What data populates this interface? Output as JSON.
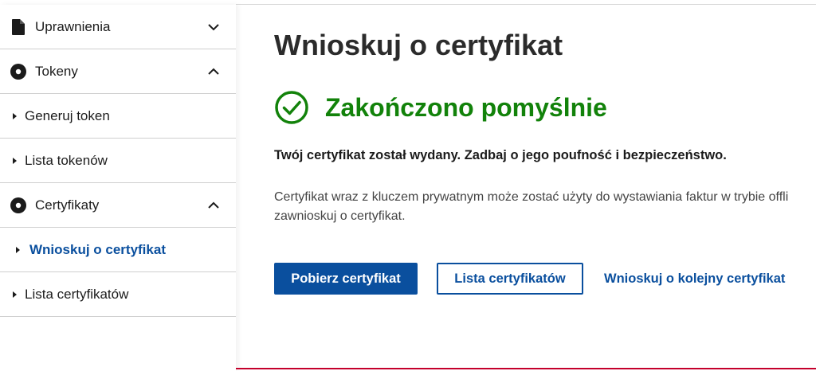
{
  "sidebar": {
    "items": [
      {
        "type": "section",
        "label": "Uprawnienia",
        "icon": "document-icon",
        "expanded": false
      },
      {
        "type": "section",
        "label": "Tokeny",
        "icon": "disc-icon",
        "expanded": true
      },
      {
        "type": "sub",
        "label": "Generuj token",
        "active": false
      },
      {
        "type": "sub",
        "label": "Lista tokenów",
        "active": false
      },
      {
        "type": "section",
        "label": "Certyfikaty",
        "icon": "disc-icon",
        "expanded": true
      },
      {
        "type": "sub",
        "label": "Wnioskuj o certyfikat",
        "active": true
      },
      {
        "type": "sub",
        "label": "Lista certyfikatów",
        "active": false
      }
    ]
  },
  "main": {
    "title": "Wnioskuj o certyfikat",
    "status": {
      "text": "Zakończono pomyślnie",
      "icon": "check-circle-icon",
      "color": "#12820a"
    },
    "lead": "Twój certyfikat został wydany. Zadbaj o jego poufność i bezpieczeństwo.",
    "description_line1": "Certyfikat wraz z kluczem prywatnym może zostać użyty do wystawiania faktur w trybie offli",
    "description_line2": "zawnioskuj o certyfikat.",
    "buttons": {
      "download": "Pobierz certyfikat",
      "list": "Lista certyfikatów",
      "request_another": "Wnioskuj o kolejny certyfikat"
    }
  },
  "colors": {
    "accent": "#0a4f9e",
    "success": "#12820a",
    "footer_line": "#c4002b"
  }
}
